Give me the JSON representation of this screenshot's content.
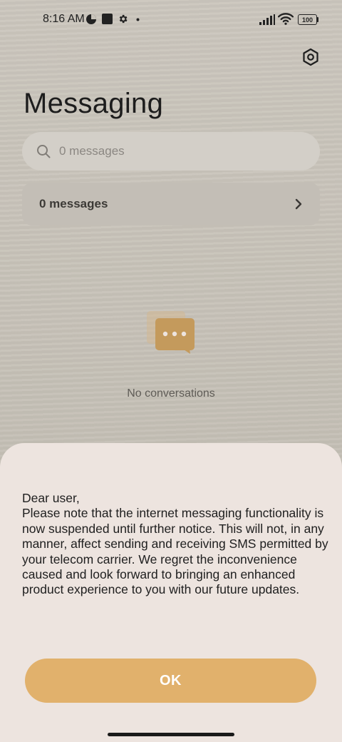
{
  "status_bar": {
    "time": "8:16 AM",
    "battery": "100",
    "icons": [
      "data-saver-icon",
      "stop-icon",
      "gear-icon",
      "dot-icon",
      "signal-icon",
      "wifi-icon",
      "battery-icon"
    ]
  },
  "header": {
    "title": "Messaging",
    "settings_icon": "settings-hex-icon"
  },
  "search": {
    "placeholder": "0 messages",
    "icon": "search-icon"
  },
  "messages_row": {
    "label": "0 messages",
    "icon": "chevron-right-icon"
  },
  "empty_state": {
    "icon": "chat-bubbles-icon",
    "text": "No conversations"
  },
  "dialog": {
    "greeting": "Dear user,",
    "body": "Please note that the internet messaging functionality is now suspended until further notice. This will not, in any manner, affect sending and receiving SMS permitted by your telecom carrier. We regret the inconvenience caused and look forward to bringing an enhanced product experience to you with our future updates.",
    "ok_label": "OK"
  },
  "colors": {
    "accent": "#e1b16c",
    "sheet": "#ede4df",
    "icon_brown": "#c49a5c"
  }
}
